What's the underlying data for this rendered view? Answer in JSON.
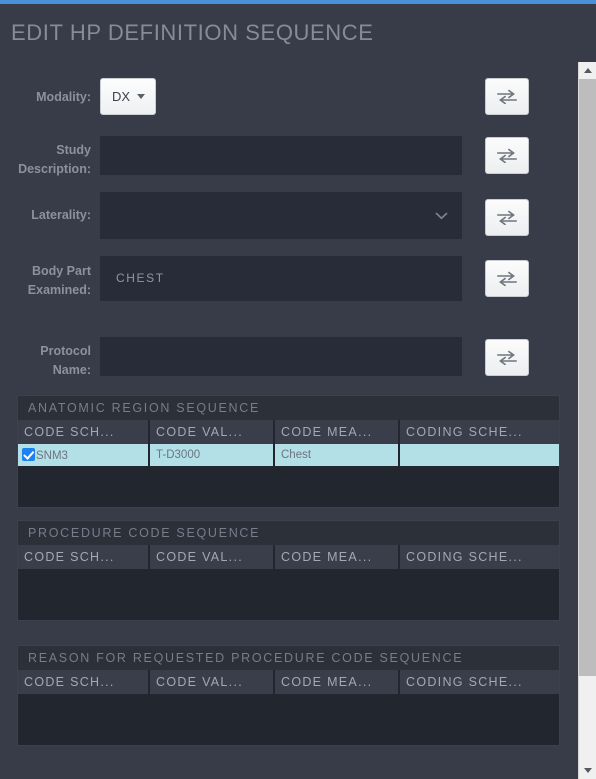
{
  "window": {
    "title": "EDIT HP DEFINITION SEQUENCE",
    "accent_color": "#4a90d9",
    "background_color": "#373c48",
    "field_background_color": "#282c38",
    "selection_color": "#b3dfe6",
    "checkbox_color": "#1b82f0"
  },
  "form": {
    "swap_icon": "swap-horizontal-icon",
    "fields": [
      {
        "label": "Modality:",
        "type": "combobox",
        "value": "DX",
        "placeholder": "",
        "has_swap_button": true
      },
      {
        "label": "Study Description:",
        "type": "text",
        "value": "",
        "placeholder": "",
        "has_swap_button": true
      },
      {
        "label": "Laterality:",
        "type": "select",
        "value": "",
        "placeholder": "",
        "has_swap_button": true
      },
      {
        "label": "Body Part Examined:",
        "type": "text",
        "value": "CHEST",
        "placeholder": "",
        "has_swap_button": true
      },
      {
        "label": "Protocol Name:",
        "type": "text",
        "value": "",
        "placeholder": "",
        "has_swap_button": true
      }
    ]
  },
  "sequences": [
    {
      "title": "ANATOMIC REGION SEQUENCE",
      "columns": [
        "CODE SCH...",
        "CODE VAL...",
        "CODE MEA...",
        "CODING SCHE..."
      ],
      "rows": [
        {
          "selected": true,
          "checked": true,
          "cells": [
            "SNM3",
            "T-D3000",
            "Chest",
            ""
          ]
        }
      ]
    },
    {
      "title": "PROCEDURE CODE SEQUENCE",
      "columns": [
        "CODE SCH...",
        "CODE VAL...",
        "CODE MEA...",
        "CODING SCHE..."
      ],
      "rows": []
    },
    {
      "title": "REASON FOR REQUESTED PROCEDURE CODE SEQUENCE",
      "columns": [
        "CODE SCH...",
        "CODE VAL...",
        "CODE MEA...",
        "CODING SCHE..."
      ],
      "rows": []
    }
  ],
  "scrollbar": {
    "up_arrow": "chevron-up-icon",
    "down_arrow": "chevron-down-icon",
    "thumb_position": "top"
  }
}
